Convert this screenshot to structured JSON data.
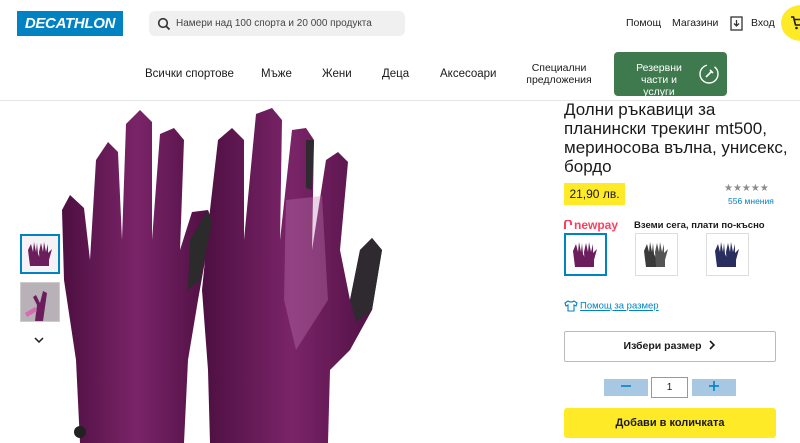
{
  "header": {
    "logo": "DECATHLON",
    "search_placeholder": "Намери над 100 спорта и 20 000 продукта",
    "help": "Помощ",
    "stores": "Магазини",
    "login": "Вход"
  },
  "nav": {
    "items": [
      "Всички спортове",
      "Мъже",
      "Жени",
      "Деца",
      "Аксесоари"
    ],
    "special_line1": "Специални",
    "special_line2": "предложения",
    "spare_line1": "Резервни",
    "spare_line2": "части и услуги"
  },
  "product": {
    "title": "Долни ръкавици за планински трекинг mt500, мериносова вълна, унисекс, бордо",
    "price": "21,90 лв.",
    "stars": "★★★★★",
    "rating": 4.5,
    "reviews": "556 мнения",
    "newpay_logo": "newpay",
    "newpay_text": "Вземи сега, плати по-късно",
    "swatch_colors": [
      "#6b1d5c",
      "#3a3a3a",
      "#2a2e5e"
    ],
    "size_help": "Помощ за размер",
    "choose_size": "Избери размер",
    "quantity": "1",
    "add_to_cart": "Добави в количката"
  },
  "colors": {
    "brand_blue": "#0082c3",
    "yellow": "#ffea28",
    "green": "#3f7a4f",
    "glove": "#6b1d5c"
  }
}
